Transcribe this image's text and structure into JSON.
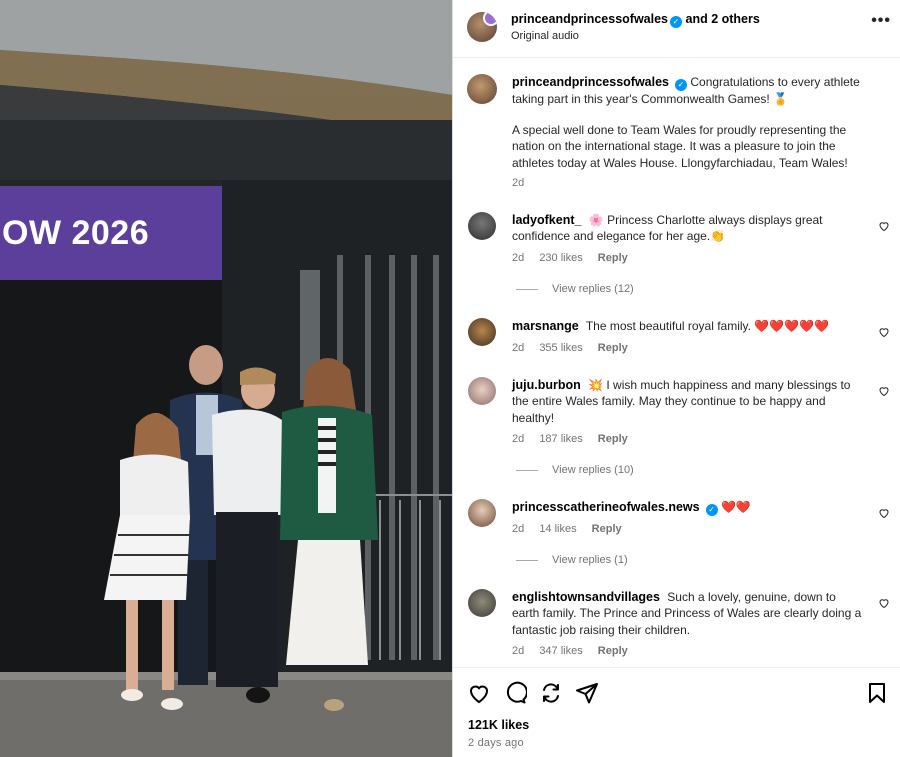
{
  "post": {
    "author": "princeandprincessofwales",
    "coauthors": "and 2 others",
    "audio": "Original audio",
    "sign_text": "OW 2026"
  },
  "caption": {
    "username": "princeandprincessofwales",
    "text1": "Congratulations to every athlete taking part in this year's Commonwealth Games! 🏅",
    "text2": "A special well done to Team Wales for proudly representing the nation on the international stage. It was a pleasure to join the athletes today at Wales House. Llongyfarchiadau, Team Wales!",
    "time": "2d"
  },
  "comments": [
    {
      "username": "ladyofkent_",
      "text": "🌸 Princess Charlotte always displays great confidence and elegance for her age.👏",
      "time": "2d",
      "likes": "230 likes",
      "reply": "Reply",
      "view_replies": "View replies (12)"
    },
    {
      "username": "marsnange",
      "text": "The most beautiful royal family. ❤️❤️❤️❤️❤️",
      "time": "2d",
      "likes": "355 likes",
      "reply": "Reply"
    },
    {
      "username": "juju.burbon",
      "text": "💥 I wish much happiness and many blessings to the entire Wales family. May they continue to be happy and healthy!",
      "time": "2d",
      "likes": "187 likes",
      "reply": "Reply",
      "view_replies": "View replies (10)"
    },
    {
      "username": "princesscatherineofwales.news",
      "text": "❤️❤️",
      "time": "2d",
      "likes": "14 likes",
      "reply": "Reply",
      "view_replies": "View replies (1)"
    },
    {
      "username": "englishtownsandvillages",
      "text": "Such a lovely, genuine, down to earth family. The Prince and Princess of Wales are clearly doing a fantastic job raising their children.",
      "time": "2d",
      "likes": "347 likes",
      "reply": "Reply"
    }
  ],
  "footer": {
    "likes": "121K likes",
    "ago": "2 days ago"
  },
  "colors": {
    "verified": "#0095f6",
    "sign": "#5b3f9a",
    "secondary_text": "#737373"
  },
  "icons": [
    "more-options-icon",
    "verified-icon",
    "heart-icon",
    "comment-icon",
    "share-icon",
    "send-icon",
    "bookmark-icon"
  ]
}
